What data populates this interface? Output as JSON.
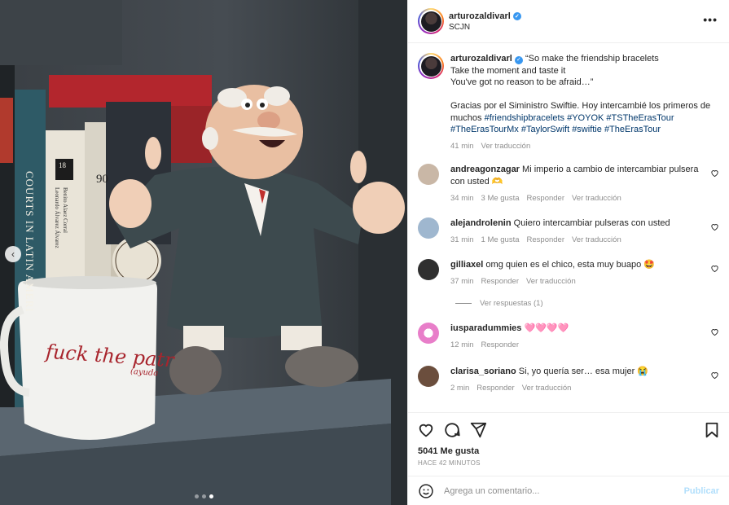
{
  "media": {
    "mug_text": "fuck the patr",
    "mug_sub": "(ayuda",
    "book_spines": [
      "COURTS IN LATIN AMERI",
      "18",
      "90",
      "Benito Alaez Corral",
      "Leonardo Álvarez Álvarez"
    ]
  },
  "post": {
    "username": "arturozaldivarl",
    "location": "SCJN",
    "caption": {
      "username": "arturozaldivarl",
      "lines": [
        "“So make the friendship bracelets",
        "Take the moment and taste it",
        "You've got no reason to be afraid…”"
      ],
      "text_1": "Gracias por el Siministro Swiftie. Hoy intercambié los primeros de muchos ",
      "tags": [
        "#friendshipbracelets",
        "#YOYOK",
        "#TSTheErasTour",
        "#TheErasTourMx",
        "#TaylorSwift",
        "#swiftie",
        "#TheErasTour"
      ],
      "time": "41 min",
      "translate": "Ver traducción"
    },
    "comments": [
      {
        "username": "andreagonzagar",
        "text": "Mi imperio a cambio de intercambiar pulsera con usted 🫶",
        "time": "34 min",
        "likes": "3 Me gusta",
        "reply": "Responder",
        "translate": "Ver traducción",
        "avatar_color": "#c9b7a6"
      },
      {
        "username": "alejandrolenin",
        "text": "Quiero intercambiar pulseras con usted",
        "time": "31 min",
        "likes": "1 Me gusta",
        "reply": "Responder",
        "translate": "Ver traducción",
        "avatar_color": "#9fb7cf"
      },
      {
        "username": "gilliaxel",
        "text": "omg quien es el chico, esta muy buapo 🤩",
        "time": "37 min",
        "likes": "",
        "reply": "Responder",
        "translate": "Ver traducción",
        "avatar_color": "#2f2f2f"
      },
      {
        "username": "iusparadummies",
        "text": "🩷🩷🩷🩷",
        "time": "12 min",
        "likes": "",
        "reply": "Responder",
        "translate": "",
        "avatar_color": "#e87ec9"
      },
      {
        "username": "clarisa_soriano",
        "text": "Si, yo quería ser… esa mujer 😭",
        "time": "2 min",
        "likes": "",
        "reply": "Responder",
        "translate": "Ver traducción",
        "avatar_color": "#6b4e3d"
      }
    ],
    "view_replies": "Ver respuestas (1)",
    "like_count": "5041 Me gusta",
    "posted_ago": "HACE 42 MINUTOS",
    "comment_placeholder": "Agrega un comentario...",
    "publish_label": "Publicar"
  }
}
